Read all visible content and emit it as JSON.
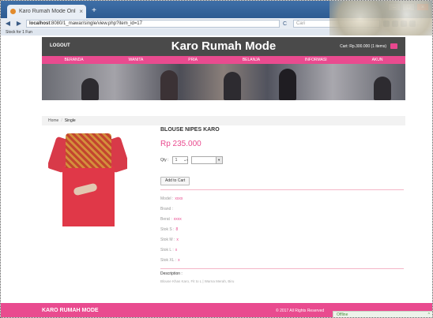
{
  "browser": {
    "tab_title": "Karo Rumah Mode Online",
    "tab_close": "×",
    "new_tab": "+",
    "url_host": "localhost",
    "url_rest": ":8080/1_mawar/single/view.php?item_id=17",
    "search_placeholder": "Cari",
    "bookmarks_label": "Stock for 1 Fun",
    "back": "◀",
    "forward": "▶",
    "reload": "C"
  },
  "header": {
    "logout": "LOGOUT",
    "brand": "Karo Rumah Mode",
    "cart": "Cart: Rp.300.000 (1 items)"
  },
  "nav": {
    "items": [
      "BERANDA",
      "WANITA",
      "PRIA",
      "BELANJA",
      "INFORMASI",
      "AKUN"
    ]
  },
  "breadcrumb": {
    "home": "Home",
    "separator": "/",
    "current": "Single"
  },
  "product": {
    "name": "BLOUSE NIPES KARO",
    "price": "Rp 235.000",
    "qty_label": "Qty :",
    "qty_value": "1",
    "add_to_cart": "Add to Cart",
    "attributes": [
      {
        "label": "Model :",
        "value": "xxxx"
      },
      {
        "label": "Brand :",
        "value": ""
      },
      {
        "label": "Berat :",
        "value": "xxxx"
      },
      {
        "label": "Stok S :",
        "value": "8"
      },
      {
        "label": "Stok M :",
        "value": "x"
      },
      {
        "label": "Stok L :",
        "value": "x"
      },
      {
        "label": "Stok XL :",
        "value": "x"
      }
    ],
    "description_label": "Description :",
    "description": "Blouse Khas Karo, Fit to L | Warna Merah, Biru"
  },
  "footer": {
    "brand": "KARO RUMAH MODE",
    "copyright": "© 2017 All Rights Reserved"
  },
  "status": {
    "offline": "Offline",
    "caret": "^"
  },
  "colors": {
    "accent": "#e94b8f",
    "header": "#4a4a4a"
  }
}
